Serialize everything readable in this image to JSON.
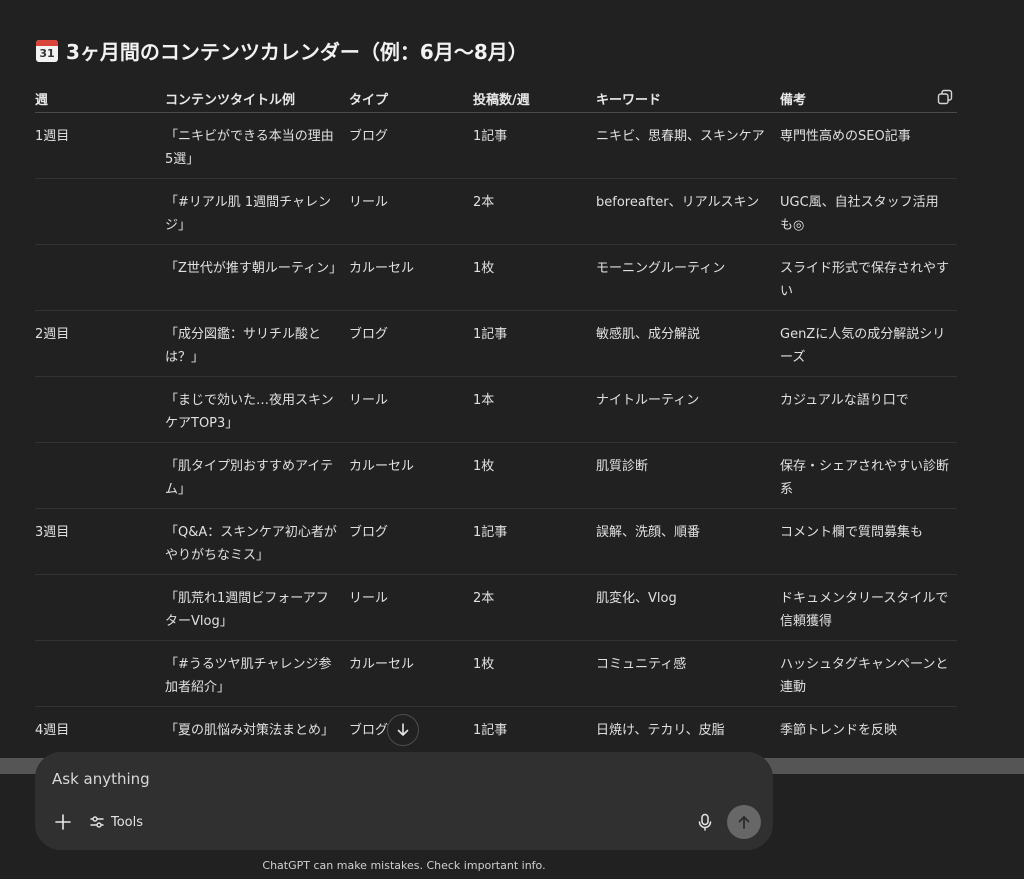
{
  "heading": {
    "calendar_icon_text": "31",
    "title": "3ヶ月間のコンテンツカレンダー（例：6月〜8月）"
  },
  "table": {
    "headers": [
      "週",
      "コンテンツタイトル例",
      "タイプ",
      "投稿数/週",
      "キーワード",
      "備考"
    ],
    "rows": [
      {
        "week": "1週目",
        "title": "「ニキビができる本当の理由5選」",
        "type": "ブログ",
        "freq": "1記事",
        "keywords": "ニキビ、思春期、スキンケア",
        "note": "専門性高めのSEO記事"
      },
      {
        "week": "",
        "title": "「#リアル肌 1週間チャレンジ」",
        "type": "リール",
        "freq": "2本",
        "keywords": "beforeafter、リアルスキン",
        "note": "UGC風、自社スタッフ活用も◎"
      },
      {
        "week": "",
        "title": "「Z世代が推す朝ルーティン」",
        "type": "カルーセル",
        "freq": "1枚",
        "keywords": "モーニングルーティン",
        "note": "スライド形式で保存されやすい"
      },
      {
        "week": "2週目",
        "title": "「成分図鑑：サリチル酸とは？」",
        "type": "ブログ",
        "freq": "1記事",
        "keywords": "敏感肌、成分解説",
        "note": "GenZに人気の成分解説シリーズ"
      },
      {
        "week": "",
        "title": "「まじで効いた…夜用スキンケアTOP3」",
        "type": "リール",
        "freq": "1本",
        "keywords": "ナイトルーティン",
        "note": "カジュアルな語り口で"
      },
      {
        "week": "",
        "title": "「肌タイプ別おすすめアイテム」",
        "type": "カルーセル",
        "freq": "1枚",
        "keywords": "肌質診断",
        "note": "保存・シェアされやすい診断系"
      },
      {
        "week": "3週目",
        "title": "「Q&A：スキンケア初心者がやりがちなミス」",
        "type": "ブログ",
        "freq": "1記事",
        "keywords": "誤解、洗顔、順番",
        "note": "コメント欄で質問募集も"
      },
      {
        "week": "",
        "title": "「肌荒れ1週間ビフォーアフターVlog」",
        "type": "リール",
        "freq": "2本",
        "keywords": "肌変化、Vlog",
        "note": "ドキュメンタリースタイルで信頼獲得"
      },
      {
        "week": "",
        "title": "「#うるツヤ肌チャレンジ参加者紹介」",
        "type": "カルーセル",
        "freq": "1枚",
        "keywords": "コミュニティ感",
        "note": "ハッシュタグキャンペーンと連動"
      },
      {
        "week": "4週目",
        "title": "「夏の肌悩み対策法まとめ」",
        "type": "ブログ",
        "freq": "1記事",
        "keywords": "日焼け、テカリ、皮脂",
        "note": "季節トレンドを反映"
      }
    ]
  },
  "composer": {
    "placeholder": "Ask anything",
    "tools_label": "Tools"
  },
  "footer": {
    "disclaimer": "ChatGPT can make mistakes. Check important info."
  },
  "icons": {
    "calendar": "calendar-icon",
    "copy": "copy-icon",
    "scroll_down": "arrow-down-icon",
    "plus": "plus-icon",
    "tools": "sliders-icon",
    "mic": "microphone-icon",
    "send": "arrow-up-icon"
  },
  "colors": {
    "background": "#212121",
    "composer": "#303030",
    "send_button": "#676767",
    "calendar_red": "#d8453b"
  }
}
